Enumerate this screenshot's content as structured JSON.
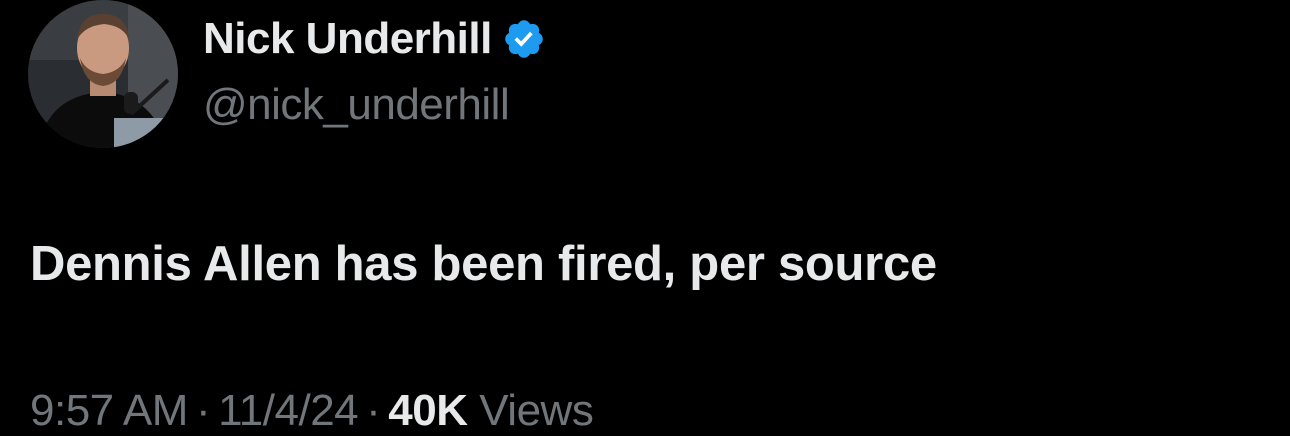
{
  "tweet": {
    "author": {
      "display_name": "Nick Underhill",
      "handle": "@nick_underhill",
      "verified": true,
      "avatar_icon": "profile-photo-icon",
      "verified_icon": "verified-badge-icon"
    },
    "text": "Dennis Allen has been fired, per source",
    "meta": {
      "time": "9:57 AM",
      "separator": "·",
      "date": "11/4/24",
      "views_count": "40K",
      "views_label": "Views"
    }
  },
  "colors": {
    "background": "#000000",
    "primary_text": "#e7e9ea",
    "secondary_text": "#71767b",
    "verified_blue": "#1d9bf0"
  }
}
